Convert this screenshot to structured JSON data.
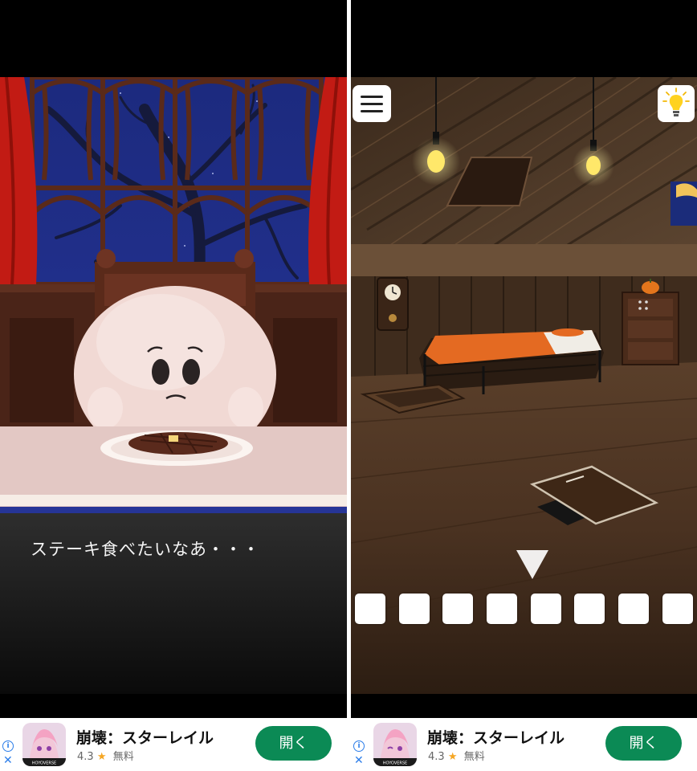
{
  "left_screen": {
    "dialog_text": "ステーキ食べたいなあ・・・"
  },
  "right_screen": {
    "menu_icon": "hamburger-menu-icon",
    "hint_icon": "lightbulb-icon",
    "nav_icon": "down-arrow-icon",
    "inventory_slot_count": 8
  },
  "ads": [
    {
      "app_name": "崩壊：スターレイル",
      "rating": "4.3",
      "rating_icon": "star-icon",
      "price": "無料",
      "button_label": "開く",
      "badge_text": "HOYOVERSE"
    },
    {
      "app_name": "崩壊：スターレイル",
      "rating": "4.3",
      "rating_icon": "star-icon",
      "price": "無料",
      "button_label": "開く",
      "badge_text": "HOYOVERSE"
    }
  ],
  "colors": {
    "ad_button": "#0b8a55",
    "curtain": "#c21b14",
    "bed_cover": "#e46a22",
    "night_sky": "#243394"
  }
}
